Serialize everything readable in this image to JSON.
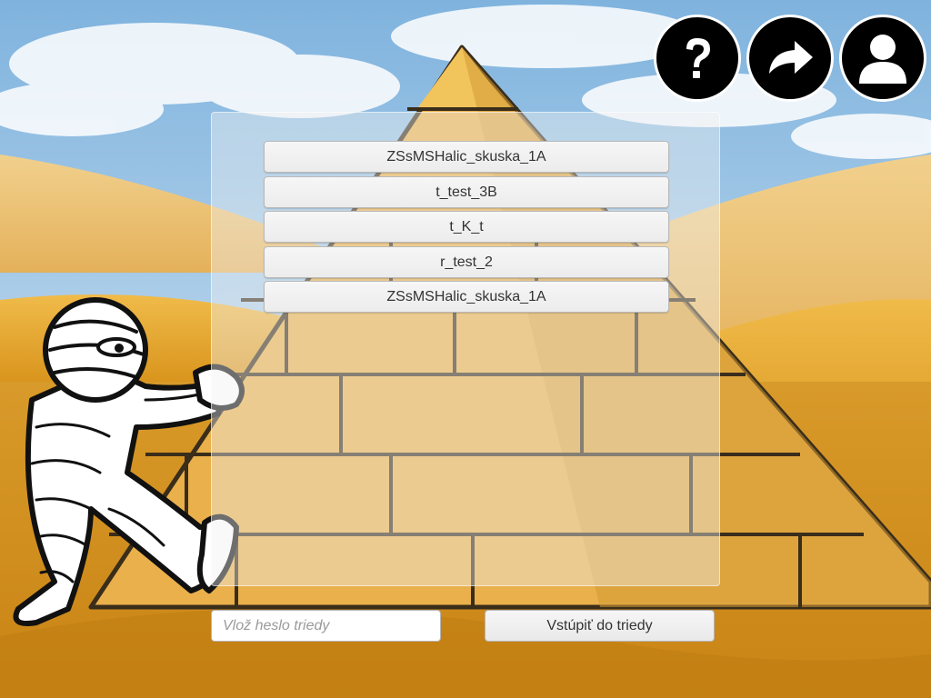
{
  "toolbar": {
    "help": {
      "icon": "question-mark-icon"
    },
    "share": {
      "icon": "redo-arrow-icon"
    },
    "profile": {
      "icon": "user-icon"
    }
  },
  "class_list": {
    "items": [
      "ZSsMSHalic_skuska_1A",
      "t_test_3B",
      "t_K_t",
      "r_test_2",
      "ZSsMSHalic_skuska_1A"
    ]
  },
  "join": {
    "password_placeholder": "Vlož heslo triedy",
    "password_value": "",
    "button_label": "Vstúpiť do triedy"
  },
  "colors": {
    "sky": "#9fc6e6",
    "sand": "#e9b23a",
    "pyramid": "#e8b04a",
    "button_bg": "#f2f2f2"
  }
}
